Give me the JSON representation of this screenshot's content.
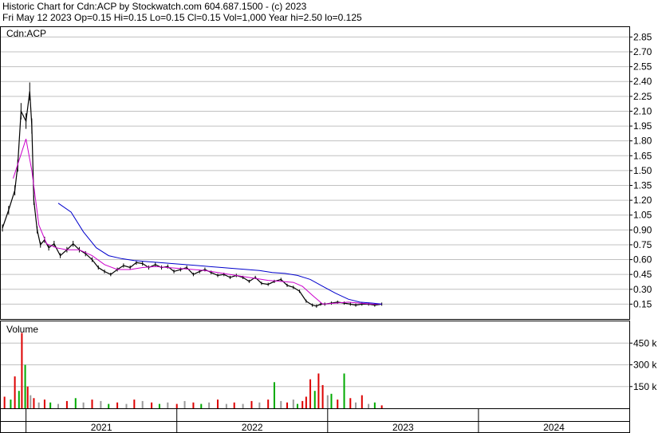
{
  "header": {
    "line1": "Historic Chart for Cdn:ACP by Stockwatch.com 604.687.1500 - (c) 2023",
    "line2": "Fri May 12 2023   Op=0.15  Hi=0.15  Lo=0.15  Cl=0.15  Vol=1,000  Year hi=2.50  lo=0.125"
  },
  "colors": {
    "price": "#000000",
    "ma_short": "#cc00cc",
    "ma_long": "#0000cc",
    "vol_red": "#dd0000",
    "vol_green": "#00aa00",
    "vol_gray": "#999999",
    "grid": "#c0c0c0"
  },
  "chart_data": [
    {
      "type": "line",
      "title": "Cdn:ACP",
      "ylim": [
        0,
        2.95
      ],
      "y_ticks": [
        0.15,
        0.3,
        0.45,
        0.6,
        0.75,
        0.9,
        1.05,
        1.2,
        1.35,
        1.5,
        1.65,
        1.8,
        1.95,
        2.1,
        2.25,
        2.4,
        2.55,
        2.7,
        2.85
      ],
      "y_tick_labels": [
        "0.15",
        "0.30",
        "0.45",
        "0.60",
        "0.75",
        "0.90",
        "1.05",
        "1.20",
        "1.35",
        "1.50",
        "1.65",
        "1.80",
        "1.95",
        "2.10",
        "2.25",
        "2.40",
        "2.55",
        "2.70",
        "2.85"
      ],
      "x_ticks": [
        "2021",
        "2022",
        "2023",
        "2024"
      ],
      "grid": "horizontal",
      "series": [
        {
          "kind": "price",
          "x": [
            "2020-11-05",
            "2020-11-20",
            "2020-12-05",
            "2020-12-12",
            "2020-12-20",
            "2021-01-01",
            "2021-01-10",
            "2021-01-15",
            "2021-01-20",
            "2021-01-28",
            "2021-02-05",
            "2021-02-15",
            "2021-02-25",
            "2021-03-10",
            "2021-03-25",
            "2021-04-10",
            "2021-04-25",
            "2021-05-10",
            "2021-05-25",
            "2021-06-10",
            "2021-06-25",
            "2021-07-10",
            "2021-07-25",
            "2021-08-10",
            "2021-08-25",
            "2021-09-10",
            "2021-09-25",
            "2021-10-10",
            "2021-10-25",
            "2021-11-10",
            "2021-11-25",
            "2021-12-10",
            "2021-12-25",
            "2022-01-10",
            "2022-01-25",
            "2022-02-10",
            "2022-02-25",
            "2022-03-10",
            "2022-03-25",
            "2022-04-10",
            "2022-04-25",
            "2022-05-10",
            "2022-05-25",
            "2022-06-10",
            "2022-06-25",
            "2022-07-10",
            "2022-07-25",
            "2022-08-10",
            "2022-08-25",
            "2022-09-10",
            "2022-09-25",
            "2022-10-10",
            "2022-10-25",
            "2022-11-10",
            "2022-11-25",
            "2022-12-05",
            "2022-12-15",
            "2022-12-25",
            "2023-01-10",
            "2023-01-25",
            "2023-02-10",
            "2023-02-25",
            "2023-03-10",
            "2023-03-25",
            "2023-04-10",
            "2023-04-25",
            "2023-05-12"
          ],
          "values": [
            0.92,
            1.1,
            1.3,
            1.55,
            2.1,
            2.0,
            2.3,
            1.95,
            1.2,
            0.9,
            0.75,
            0.8,
            0.72,
            0.76,
            0.64,
            0.7,
            0.76,
            0.7,
            0.66,
            0.6,
            0.52,
            0.48,
            0.45,
            0.5,
            0.54,
            0.52,
            0.57,
            0.56,
            0.52,
            0.55,
            0.52,
            0.53,
            0.48,
            0.5,
            0.52,
            0.45,
            0.48,
            0.5,
            0.47,
            0.44,
            0.45,
            0.42,
            0.44,
            0.42,
            0.38,
            0.42,
            0.36,
            0.35,
            0.38,
            0.4,
            0.34,
            0.32,
            0.28,
            0.18,
            0.14,
            0.13,
            0.15,
            0.15,
            0.16,
            0.17,
            0.16,
            0.15,
            0.14,
            0.15,
            0.15,
            0.14,
            0.15
          ]
        },
        {
          "kind": "ma_short",
          "x": [
            "2020-12-01",
            "2021-01-01",
            "2021-01-15",
            "2021-02-01",
            "2021-02-20",
            "2021-03-15",
            "2021-04-10",
            "2021-05-10",
            "2021-06-10",
            "2021-07-10",
            "2021-08-10",
            "2021-09-10",
            "2021-10-10",
            "2021-11-10",
            "2021-12-10",
            "2022-01-10",
            "2022-02-10",
            "2022-03-10",
            "2022-04-10",
            "2022-05-10",
            "2022-06-10",
            "2022-07-10",
            "2022-08-10",
            "2022-09-10",
            "2022-10-10",
            "2022-11-01",
            "2022-11-25",
            "2022-12-20",
            "2023-01-20",
            "2023-02-20",
            "2023-03-20",
            "2023-04-20",
            "2023-05-12"
          ],
          "values": [
            1.42,
            1.82,
            1.5,
            0.95,
            0.76,
            0.72,
            0.7,
            0.7,
            0.64,
            0.55,
            0.5,
            0.5,
            0.52,
            0.53,
            0.52,
            0.51,
            0.5,
            0.49,
            0.47,
            0.45,
            0.43,
            0.41,
            0.39,
            0.38,
            0.37,
            0.33,
            0.24,
            0.15,
            0.16,
            0.17,
            0.16,
            0.15,
            0.15
          ]
        },
        {
          "kind": "ma_long",
          "x": [
            "2021-03-20",
            "2021-04-20",
            "2021-05-20",
            "2021-06-20",
            "2021-07-20",
            "2021-08-20",
            "2021-09-20",
            "2021-10-20",
            "2021-11-20",
            "2021-12-20",
            "2022-01-20",
            "2022-02-20",
            "2022-03-20",
            "2022-04-20",
            "2022-05-20",
            "2022-06-20",
            "2022-07-20",
            "2022-08-20",
            "2022-09-20",
            "2022-10-20",
            "2022-11-20",
            "2022-12-20",
            "2023-01-20",
            "2023-02-20",
            "2023-03-20",
            "2023-04-20",
            "2023-05-12"
          ],
          "values": [
            1.17,
            1.08,
            0.88,
            0.72,
            0.64,
            0.61,
            0.59,
            0.58,
            0.57,
            0.56,
            0.55,
            0.54,
            0.53,
            0.52,
            0.51,
            0.5,
            0.49,
            0.47,
            0.46,
            0.44,
            0.4,
            0.33,
            0.26,
            0.2,
            0.17,
            0.16,
            0.15
          ]
        }
      ]
    },
    {
      "type": "bar",
      "title": "Volume",
      "ylim": [
        0,
        600000
      ],
      "y_ticks": [
        150000,
        300000,
        450000
      ],
      "y_tick_labels": [
        "150 k",
        "300 k",
        "450 k"
      ],
      "x": [
        "2020-11-10",
        "2020-11-25",
        "2020-12-05",
        "2020-12-15",
        "2020-12-22",
        "2020-12-30",
        "2021-01-05",
        "2021-01-12",
        "2021-01-20",
        "2021-02-01",
        "2021-02-15",
        "2021-03-01",
        "2021-03-20",
        "2021-04-10",
        "2021-05-01",
        "2021-05-20",
        "2021-06-10",
        "2021-07-01",
        "2021-07-20",
        "2021-08-10",
        "2021-09-01",
        "2021-09-20",
        "2021-10-10",
        "2021-11-01",
        "2021-11-20",
        "2021-12-10",
        "2022-01-01",
        "2022-01-20",
        "2022-02-10",
        "2022-03-01",
        "2022-03-20",
        "2022-04-10",
        "2022-05-01",
        "2022-05-20",
        "2022-06-10",
        "2022-07-01",
        "2022-07-20",
        "2022-08-10",
        "2022-08-25",
        "2022-09-10",
        "2022-09-25",
        "2022-10-10",
        "2022-10-20",
        "2022-11-01",
        "2022-11-10",
        "2022-11-20",
        "2022-12-01",
        "2022-12-10",
        "2022-12-20",
        "2023-01-01",
        "2023-01-10",
        "2023-01-25",
        "2023-02-10",
        "2023-02-25",
        "2023-03-10",
        "2023-03-25",
        "2023-04-10",
        "2023-04-25",
        "2023-05-12"
      ],
      "values": [
        80000,
        60000,
        220000,
        120000,
        520000,
        300000,
        150000,
        90000,
        70000,
        40000,
        60000,
        40000,
        30000,
        50000,
        70000,
        40000,
        60000,
        50000,
        30000,
        40000,
        30000,
        60000,
        50000,
        40000,
        30000,
        40000,
        30000,
        50000,
        40000,
        30000,
        40000,
        60000,
        30000,
        40000,
        30000,
        50000,
        40000,
        60000,
        180000,
        50000,
        40000,
        60000,
        30000,
        50000,
        80000,
        200000,
        120000,
        240000,
        160000,
        90000,
        100000,
        60000,
        240000,
        70000,
        40000,
        90000,
        30000,
        40000,
        20000
      ],
      "colors": [
        "red",
        "green",
        "red",
        "green",
        "red",
        "green",
        "red",
        "gray",
        "red",
        "gray",
        "red",
        "green",
        "gray",
        "red",
        "green",
        "gray",
        "red",
        "gray",
        "green",
        "red",
        "gray",
        "red",
        "gray",
        "red",
        "green",
        "gray",
        "red",
        "gray",
        "red",
        "green",
        "gray",
        "red",
        "gray",
        "red",
        "gray",
        "red",
        "gray",
        "red",
        "green",
        "gray",
        "red",
        "gray",
        "green",
        "red",
        "red",
        "red",
        "green",
        "red",
        "red",
        "gray",
        "green",
        "red",
        "green",
        "red",
        "gray",
        "red",
        "gray",
        "green",
        "red"
      ]
    }
  ]
}
